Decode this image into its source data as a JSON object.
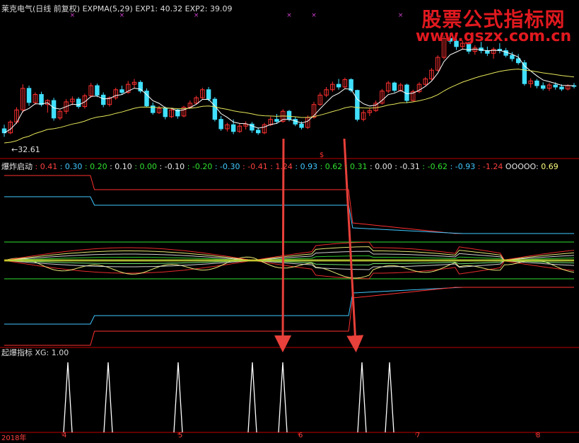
{
  "top_panel": {
    "stock_name": "莱克电气(日线 前复权)",
    "indicator": "EXPMA(5,29)",
    "exp1_label": "EXP1:",
    "exp1_value": "40.32",
    "exp2_label": "EXP2:",
    "exp2_value": "39.09",
    "low_marker": "32.61"
  },
  "mid_panel": {
    "name": "爆炸启动",
    "levels": [
      {
        "text": "0.41",
        "color": "#ff4040"
      },
      {
        "text": "0.30",
        "color": "#40c8ff"
      },
      {
        "text": "0.20",
        "color": "#30e030"
      },
      {
        "text": "0.10",
        "color": "#e8e8e8"
      },
      {
        "text": "0.00",
        "color": "#30e030"
      },
      {
        "text": "-0.10",
        "color": "#e8e8e8"
      },
      {
        "text": "-0.20",
        "color": "#30e030"
      },
      {
        "text": "-0.30",
        "color": "#40c8ff"
      },
      {
        "text": "-0.41",
        "color": "#ff4040"
      },
      {
        "text": "1.24",
        "color": "#ff4040"
      },
      {
        "text": "0.93",
        "color": "#40c8ff"
      },
      {
        "text": "0.62",
        "color": "#30e030"
      },
      {
        "text": "0.31",
        "color": "#30e030"
      },
      {
        "text": "0.00",
        "color": "#e8e8e8"
      },
      {
        "text": "-0.31",
        "color": "#e8e8e8"
      },
      {
        "text": "-0.62",
        "color": "#30e030"
      },
      {
        "text": "-0.93",
        "color": "#40c8ff"
      },
      {
        "text": "-1.24",
        "color": "#ff4040"
      }
    ],
    "last_label": "OOOOO:",
    "last_value": "0.69"
  },
  "bot_panel": {
    "name": "起爆指标",
    "xg_label": "XG:",
    "xg_value": "1.00"
  },
  "watermark": {
    "title": "股票公式指标网",
    "url": "www.gszx.com.cn"
  },
  "colors": {
    "background": "#000000",
    "up_candle": "#ff3030",
    "down_candle": "#40e0ff",
    "exp1_line": "#ffffff",
    "exp2_line": "#e6e65a",
    "panel_border": "#c00000",
    "arrow": "#e8403a",
    "signal": "#ffffff"
  },
  "chart_data": [
    {
      "type": "candlestick",
      "title": "莱克电气(日线 前复权)",
      "series": [
        {
          "name": "EXP1",
          "last": 40.32
        },
        {
          "name": "EXP2",
          "last": 39.09
        }
      ],
      "price_low_label": 32.61,
      "ylim": [
        31,
        52
      ],
      "candles": [
        [
          35.2,
          35.8,
          34.0,
          34.6
        ],
        [
          34.6,
          36.5,
          34.4,
          36.2
        ],
        [
          36.2,
          38.4,
          35.9,
          38.0
        ],
        [
          38.0,
          41.8,
          37.6,
          41.2
        ],
        [
          41.2,
          41.6,
          38.6,
          39.1
        ],
        [
          39.1,
          40.6,
          38.8,
          40.3
        ],
        [
          40.3,
          40.7,
          38.5,
          38.8
        ],
        [
          38.8,
          39.6,
          37.6,
          39.4
        ],
        [
          39.4,
          39.8,
          36.4,
          36.8
        ],
        [
          36.8,
          38.0,
          36.5,
          37.8
        ],
        [
          37.8,
          39.6,
          37.4,
          39.2
        ],
        [
          39.2,
          40.0,
          38.7,
          39.6
        ],
        [
          39.6,
          39.9,
          38.2,
          38.5
        ],
        [
          38.5,
          40.4,
          38.2,
          40.1
        ],
        [
          40.1,
          42.0,
          39.8,
          41.6
        ],
        [
          41.6,
          41.9,
          39.9,
          40.2
        ],
        [
          40.2,
          40.6,
          38.4,
          38.8
        ],
        [
          38.8,
          40.0,
          38.5,
          39.8
        ],
        [
          39.8,
          41.3,
          39.5,
          41.0
        ],
        [
          41.0,
          41.6,
          40.3,
          40.6
        ],
        [
          40.6,
          42.3,
          40.4,
          41.8
        ],
        [
          41.8,
          42.6,
          41.2,
          42.1
        ],
        [
          42.1,
          42.4,
          40.5,
          40.8
        ],
        [
          40.8,
          41.2,
          38.4,
          38.6
        ],
        [
          38.6,
          39.1,
          37.3,
          37.6
        ],
        [
          37.6,
          38.6,
          37.4,
          38.2
        ],
        [
          38.2,
          38.5,
          36.6,
          37.0
        ],
        [
          37.0,
          38.3,
          36.8,
          38.0
        ],
        [
          38.0,
          38.2,
          36.7,
          37.1
        ],
        [
          37.1,
          38.6,
          36.9,
          38.4
        ],
        [
          38.4,
          39.4,
          38.2,
          39.0
        ],
        [
          39.0,
          40.1,
          38.8,
          39.8
        ],
        [
          39.8,
          41.3,
          39.5,
          41.0
        ],
        [
          41.0,
          41.4,
          39.3,
          39.6
        ],
        [
          39.6,
          39.9,
          36.3,
          36.6
        ],
        [
          36.6,
          37.1,
          34.9,
          35.2
        ],
        [
          35.2,
          36.1,
          34.8,
          35.8
        ],
        [
          35.8,
          36.6,
          34.4,
          34.8
        ],
        [
          34.8,
          36.0,
          34.6,
          35.6
        ],
        [
          35.6,
          36.3,
          35.1,
          35.9
        ],
        [
          35.9,
          36.2,
          34.6,
          35.0
        ],
        [
          35.0,
          35.4,
          34.3,
          34.6
        ],
        [
          34.6,
          36.1,
          34.4,
          35.8
        ],
        [
          35.8,
          37.0,
          35.6,
          36.6
        ],
        [
          36.6,
          37.4,
          36.0,
          36.3
        ],
        [
          36.3,
          38.1,
          36.1,
          37.8
        ],
        [
          37.8,
          38.0,
          36.3,
          36.6
        ],
        [
          36.6,
          37.0,
          35.6,
          35.9
        ],
        [
          35.9,
          36.3,
          35.1,
          35.4
        ],
        [
          35.4,
          37.2,
          35.2,
          36.9
        ],
        [
          36.9,
          39.2,
          36.7,
          38.8
        ],
        [
          38.8,
          40.6,
          38.6,
          40.2
        ],
        [
          40.2,
          41.4,
          39.9,
          41.0
        ],
        [
          41.0,
          42.2,
          40.7,
          41.8
        ],
        [
          41.8,
          42.6,
          41.0,
          41.4
        ],
        [
          41.4,
          42.8,
          41.2,
          42.5
        ],
        [
          42.5,
          42.7,
          40.6,
          40.9
        ],
        [
          40.9,
          41.0,
          36.3,
          36.6
        ],
        [
          36.6,
          38.0,
          36.3,
          37.6
        ],
        [
          37.6,
          38.3,
          37.1,
          37.9
        ],
        [
          37.9,
          39.4,
          37.7,
          39.0
        ],
        [
          39.0,
          41.1,
          38.8,
          40.8
        ],
        [
          40.8,
          42.3,
          40.5,
          42.0
        ],
        [
          42.0,
          42.2,
          40.6,
          40.9
        ],
        [
          40.9,
          42.0,
          40.7,
          41.7
        ],
        [
          41.7,
          41.9,
          39.0,
          39.4
        ],
        [
          39.4,
          41.0,
          39.2,
          40.7
        ],
        [
          40.7,
          42.1,
          40.5,
          41.8
        ],
        [
          41.8,
          42.9,
          41.6,
          42.6
        ],
        [
          42.6,
          44.2,
          42.4,
          43.9
        ],
        [
          43.9,
          46.1,
          43.7,
          45.8
        ],
        [
          45.8,
          49.0,
          45.5,
          48.6
        ],
        [
          48.6,
          49.4,
          47.8,
          48.2
        ],
        [
          48.2,
          48.6,
          46.9,
          47.4
        ],
        [
          47.4,
          48.3,
          47.0,
          47.9
        ],
        [
          47.9,
          48.1,
          46.3,
          46.7
        ],
        [
          46.7,
          47.6,
          46.2,
          47.2
        ],
        [
          47.2,
          48.1,
          46.4,
          46.8
        ],
        [
          46.8,
          47.4,
          46.0,
          46.4
        ],
        [
          46.4,
          47.3,
          45.6,
          47.0
        ],
        [
          47.0,
          47.9,
          46.4,
          46.8
        ],
        [
          46.8,
          47.2,
          45.8,
          46.1
        ],
        [
          46.1,
          46.6,
          45.2,
          45.6
        ],
        [
          45.6,
          46.3,
          44.7,
          45.0
        ],
        [
          45.0,
          45.4,
          41.6,
          41.9
        ],
        [
          41.9,
          42.7,
          41.3,
          42.3
        ],
        [
          42.3,
          42.6,
          41.2,
          41.6
        ],
        [
          41.6,
          42.1,
          40.9,
          41.2
        ],
        [
          41.2,
          42.0,
          40.8,
          41.7
        ],
        [
          41.7,
          42.1,
          41.0,
          41.4
        ],
        [
          41.4,
          41.8,
          40.8,
          41.1
        ],
        [
          41.1,
          41.8,
          40.9,
          41.6
        ],
        [
          41.6,
          42.0,
          41.2,
          41.5
        ]
      ],
      "arrows_at_candle": [
        50,
        60
      ]
    },
    {
      "type": "line",
      "title": "爆炸启动",
      "note": "oscillator band panel",
      "last_value": 0.69
    },
    {
      "type": "spike",
      "title": "起爆指标",
      "series": [
        {
          "name": "XG",
          "last": 1.0
        }
      ],
      "signal_candles": [
        11,
        19,
        31,
        46,
        50,
        64,
        69
      ]
    }
  ],
  "xaxis": {
    "year_label": "2018年",
    "month_labels": [
      "4",
      "5",
      "6",
      "7",
      "8"
    ]
  }
}
